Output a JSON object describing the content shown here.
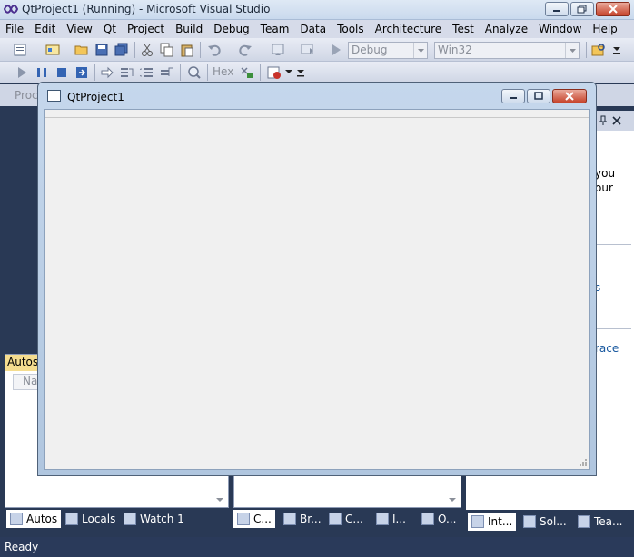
{
  "window": {
    "title": "QtProject1 (Running) - Microsoft Visual Studio"
  },
  "menu": [
    "File",
    "Edit",
    "View",
    "Qt",
    "Project",
    "Build",
    "Debug",
    "Team",
    "Data",
    "Tools",
    "Architecture",
    "Test",
    "Analyze",
    "Window",
    "Help"
  ],
  "toolbar": {
    "config_combo": "Debug",
    "platform_combo": "Win32",
    "hex_label": "Hex"
  },
  "left_panel": {
    "tab_header": "Autos",
    "column_header": "Nan"
  },
  "right_panel_fragments": [
    "you",
    "our",
    "s",
    "race"
  ],
  "process_label": "Proc",
  "bottom_tabs_left": [
    {
      "label": "Autos",
      "icon": "autos-icon",
      "active": true
    },
    {
      "label": "Locals",
      "icon": "locals-icon",
      "active": false
    },
    {
      "label": "Watch 1",
      "icon": "watch-icon",
      "active": false
    }
  ],
  "bottom_tabs_mid": [
    {
      "label": "C...",
      "icon": "callstack-icon"
    },
    {
      "label": "Br...",
      "icon": "breakpoints-icon"
    },
    {
      "label": "C...",
      "icon": "command-icon"
    },
    {
      "label": "I...",
      "icon": "immediate-icon"
    },
    {
      "label": "O...",
      "icon": "output-icon"
    }
  ],
  "bottom_tabs_right": [
    {
      "label": "Int...",
      "icon": "intellitrace-icon",
      "active": true
    },
    {
      "label": "Sol...",
      "icon": "solution-icon",
      "active": false
    },
    {
      "label": "Tea...",
      "icon": "team-icon",
      "active": false
    }
  ],
  "status": {
    "text": "Ready"
  },
  "qt_window": {
    "title": "QtProject1"
  }
}
